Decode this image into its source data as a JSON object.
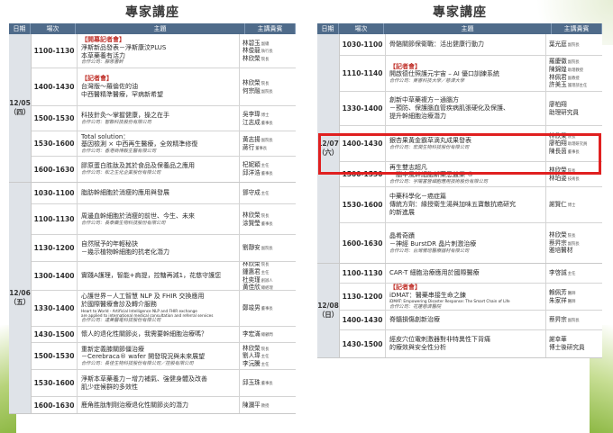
{
  "headers": {
    "date": "日期",
    "slot": "場次",
    "topic": "主題",
    "speaker": "主講貴賓"
  },
  "left_panel": {
    "title": "專家講座",
    "groups": [
      {
        "date": "12/05",
        "weekday": "（四）",
        "sessions": [
          {
            "time": "1100-1130",
            "tag": "【開幕記者會】",
            "lines": [
              "淨斯新品發表－淨斯康汶PLUS",
              "本草藥養有活力"
            ],
            "company": "合作公司：靜思書軒",
            "speakers": [
              {
                "name": "林碧玉",
                "role": "副總"
              },
              {
                "name": "林俊龍",
                "role": "執行長"
              },
              {
                "name": "林欣榮",
                "role": "院長"
              }
            ]
          },
          {
            "time": "1400-1430",
            "tag": "【記者會】",
            "lines": [
              "台灣版～羅倫佐的油",
              "中西醫精準醫療，罕病新希望"
            ],
            "company": "",
            "speakers": [
              {
                "name": "林欣榮",
                "role": "院長"
              },
              {
                "name": "何宗融",
                "role": "副院長"
              }
            ]
          },
          {
            "time": "1500-1530",
            "tag": "",
            "lines": [
              "科技針灸～掌握健康，操之在手"
            ],
            "company": "合作公司：智聯科技股份有限公司",
            "speakers": [
              {
                "name": "吳李瑋",
                "role": "博士"
              },
              {
                "name": "江志成",
                "role": "董事長"
              }
            ]
          },
          {
            "time": "1530-1600",
            "tag": "",
            "lines": [
              "Total solution：",
              "基因檢測 × 中西再生醫療，全效精準修復"
            ],
            "company": "合作公司：香港商博毅生醫有限公司",
            "speakers": [
              {
                "name": "黃志揚",
                "role": "副院長"
              },
              {
                "name": "蔣行",
                "role": "董事長"
              }
            ]
          },
          {
            "time": "1600-1630",
            "tag": "",
            "lines": [
              "膠原蛋白胜肽及其於食品及保養品之應用"
            ],
            "company": "合作公司：松之生化企業股份有限公司",
            "speakers": [
              {
                "name": "杞妮穎",
                "role": "主任"
              },
              {
                "name": "邱洋浩",
                "role": "董事長"
              }
            ]
          }
        ]
      },
      {
        "date": "12/06",
        "weekday": "（五）",
        "sessions": [
          {
            "time": "1030-1100",
            "tag": "",
            "lines": [
              "脂肪幹細胞於消瘦的應用與發展"
            ],
            "company": "",
            "speakers": [
              {
                "name": "鄧守成",
                "role": "主任"
              }
            ]
          },
          {
            "time": "1100-1130",
            "tag": "",
            "lines": [
              "周邊血幹細胞於消瘦的前世、今生、未來"
            ],
            "company": "合作公司：長泰藥生物科技股份有限公司",
            "speakers": [
              {
                "name": "林欣榮",
                "role": "院長"
              },
              {
                "name": "涂賢瑩",
                "role": "董事長"
              }
            ]
          },
          {
            "time": "1130-1200",
            "tag": "",
            "lines": [
              "自然賦予的年輕秘訣",
              "－幾示植物幹細胞的抗老化潛力"
            ],
            "company": "",
            "speakers": [
              {
                "name": "劉靜安",
                "role": "副院長"
              }
            ]
          },
          {
            "time": "1300-1400",
            "tag": "",
            "lines": [
              "實踐A護理，智能+肩提，控糖再減1，花慈守護您"
            ],
            "company": "",
            "speakers": [
              {
                "name": "林欣榮",
                "role": "院長"
              },
              {
                "name": "鍾惠君",
                "role": "主任"
              },
              {
                "name": "杜奕瑾",
                "role": "創辦人"
              },
              {
                "name": "黃佳欣",
                "role": "總經理"
              }
            ]
          },
          {
            "time": "1330-1400",
            "tag": "",
            "lines": [
              "心護世界－人工智慧 NLP 及 FHIR 交換應用",
              "於國際醫療會診及轉介服務"
            ],
            "eng": [
              "Heart to World - Artificial Intelligence NLP and FHIR exchange",
              "are applied to international medical consultation and referral services"
            ],
            "company": "合作公司：達美醫電科技股份有限公司",
            "speakers": [
              {
                "name": "鄭竣男",
                "role": "董事長"
              }
            ]
          },
          {
            "time": "1430-1500",
            "tag": "",
            "lines": [
              "懷人的退化性關節炎，我需要幹細胞治療嗎？"
            ],
            "company": "",
            "speakers": [
              {
                "name": "李宏滿",
                "role": "總顧問"
              }
            ]
          },
          {
            "time": "1500-1530",
            "tag": "",
            "lines": [
              "重新定義膝關節僵治療",
              "－Cerebraca® wafer 開發現況與未來展望"
            ],
            "company": "合作公司：長佳生物科技股份有限公司／控股有限公司",
            "speakers": [
              {
                "name": "林欣榮",
                "role": "院長"
              },
              {
                "name": "劉人瑋",
                "role": "主任"
              },
              {
                "name": "李沅騰",
                "role": "主任"
              }
            ]
          },
          {
            "time": "1530-1600",
            "tag": "",
            "lines": [
              "淨斯本草藥養力－增力補氣、強健身體及改善",
              "肌少症候群的多效性"
            ],
            "company": "",
            "speakers": [
              {
                "name": "邱玉珠",
                "role": "董事長"
              }
            ]
          },
          {
            "time": "1600-1630",
            "tag": "",
            "lines": [
              "鹿角胜肽制剛治療退化性關節炎的潛力"
            ],
            "company": "",
            "speakers": [
              {
                "name": "陳瀾平",
                "role": "教授"
              }
            ]
          }
        ]
      }
    ]
  },
  "right_panel": {
    "title": "專家講座",
    "groups": [
      {
        "date": "12/07",
        "weekday": "（六）",
        "sessions": [
          {
            "time": "1030-1100",
            "tag": "",
            "lines": [
              "骨骼關節保衛戰：活出健康行動力"
            ],
            "company": "",
            "speakers": [
              {
                "name": "葉光庭",
                "role": "副院長"
              }
            ]
          },
          {
            "time": "1110-1140",
            "tag": "【記者會】",
            "lines": [
              "開啟德仕照護元宇宙 – AI 優口訓練系統"
            ],
            "company": "合作公司：東睿科技大學／慈濟大學",
            "speakers": [
              {
                "name": "羅慶徽",
                "role": "副院長"
              },
              {
                "name": "陳錦煌",
                "role": "助理教授"
              },
              {
                "name": "林佩君",
                "role": "副教授"
              },
              {
                "name": "許美玉",
                "role": "護理部主任"
              }
            ]
          },
          {
            "time": "1330-1400",
            "tag": "",
            "lines": [
              "創新中草藥複方－通腦方",
              "－預防、保護腦血管疾病肌張硬化及保護、",
              "提升幹細胞治療潛力"
            ],
            "company": "",
            "speakers": [
              {
                "name": "廖柏翔",
                "role": ""
              },
              {
                "name": "助理研究員",
                "role": ""
              }
            ]
          },
          {
            "time": "1400-1430",
            "tag": "",
            "lines": [
              "銀杏果黃金霸草滴丸成果發表"
            ],
            "company": "合作公司：宏潤生物科技股份有限公司",
            "speakers": [
              {
                "name": "林欣榮",
                "role": "院長"
              },
              {
                "name": "廖柏翔",
                "role": "助理研究員"
              },
              {
                "name": "陳長茵",
                "role": "董事長"
              }
            ]
          },
          {
            "time": "1500-1530",
            "tag": "",
            "lines": [
              "再生雙志超凡",
              "－腦中風幹細胞新藥思益樂 ®"
            ],
            "company": "合作公司：宇陽富營細胞應用技術股份有限公司",
            "speakers": [
              {
                "name": "林欣榮",
                "role": "院長"
              },
              {
                "name": "林珀姿",
                "role": "技術長"
              }
            ]
          },
          {
            "time": "1530-1600",
            "tag": "",
            "lines": [
              "中藥科學化－癌症篇",
              "傳統方劑：緣授衛生湯與加味五寶散抗癌研究",
              "的新進展"
            ],
            "company": "",
            "speakers": [
              {
                "name": "謝賢仁",
                "role": "博士"
              }
            ]
          },
          {
            "time": "1600-1630",
            "tag": "",
            "lines": [
              "晶肴奇蹟",
              "－神經 BurstDR 晶片刺激治療"
            ],
            "company": "合作公司：台灣雅培醫療器材有限公司",
            "speakers": [
              {
                "name": "林欣榮",
                "role": "院長"
              },
              {
                "name": "蔡昇宗",
                "role": "副院長"
              },
              {
                "name": "雅培醫材",
                "role": ""
              }
            ]
          }
        ]
      },
      {
        "date": "12/08",
        "weekday": "（日）",
        "sessions": [
          {
            "time": "1100-1130",
            "tag": "",
            "lines": [
              "CAR-T 細胞治療應用於國際醫療"
            ],
            "company": "",
            "speakers": [
              {
                "name": "李啓誠",
                "role": "主任"
              }
            ]
          },
          {
            "time": "1130-1200",
            "tag": "【記者會】",
            "lines": [
              "iDMAT：醫藥串接生命之鍊"
            ],
            "eng": [
              "iDMAT: Empowering Disaster Response: The Smart Chain of Life"
            ],
            "company": "合作公司：花蓮慈濟醫院",
            "speakers": [
              {
                "name": "賴佩芳",
                "role": "醫師"
              },
              {
                "name": "朱家祥",
                "role": "醫師"
              }
            ]
          },
          {
            "time": "1400-1430",
            "tag": "",
            "lines": [
              "脊髓損傷創新治療"
            ],
            "company": "",
            "speakers": [
              {
                "name": "蔡昇宗",
                "role": "副院長"
              }
            ]
          },
          {
            "time": "1430-1500",
            "tag": "",
            "lines": [
              "經皮穴位電刺激器對非特異性下背痛",
              "的療效與安全性分析"
            ],
            "company": "",
            "speakers": [
              {
                "name": "謝幸華",
                "role": ""
              },
              {
                "name": "博士後研究員",
                "role": ""
              }
            ]
          }
        ]
      }
    ]
  },
  "colors": {
    "header_bg": "#4f6b8a",
    "date_bg": "#dfe3e8",
    "highlight": "#e02020",
    "tag": "#c0322b",
    "accent_green": "#8db844"
  }
}
